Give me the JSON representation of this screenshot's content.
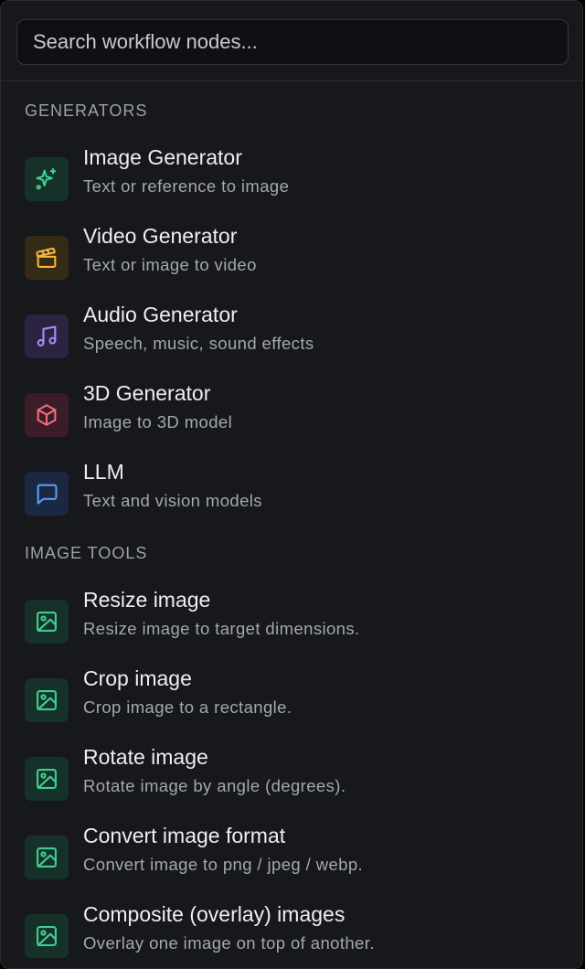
{
  "search": {
    "placeholder": "Search workflow nodes...",
    "value": ""
  },
  "sections": [
    {
      "title": "GENERATORS",
      "items": [
        {
          "title": "Image Generator",
          "description": "Text or reference to image",
          "icon": "sparkles-icon",
          "color": "#3ecf8e"
        },
        {
          "title": "Video Generator",
          "description": "Text or image to video",
          "icon": "clapperboard-icon",
          "color": "#f5b43c"
        },
        {
          "title": "Audio Generator",
          "description": "Speech, music, sound effects",
          "icon": "music-note-icon",
          "color": "#a78bfa"
        },
        {
          "title": "3D Generator",
          "description": "Image to 3D model",
          "icon": "cube-icon",
          "color": "#f06b82"
        },
        {
          "title": "LLM",
          "description": "Text and vision models",
          "icon": "chat-bubble-icon",
          "color": "#5b9cf0"
        }
      ]
    },
    {
      "title": "IMAGE TOOLS",
      "items": [
        {
          "title": "Resize image",
          "description": "Resize image to target dimensions.",
          "icon": "image-icon",
          "color": "#3ecf8e"
        },
        {
          "title": "Crop image",
          "description": "Crop image to a rectangle.",
          "icon": "image-icon",
          "color": "#3ecf8e"
        },
        {
          "title": "Rotate image",
          "description": "Rotate image by angle (degrees).",
          "icon": "image-icon",
          "color": "#3ecf8e"
        },
        {
          "title": "Convert image format",
          "description": "Convert image to png / jpeg / webp.",
          "icon": "image-icon",
          "color": "#3ecf8e"
        },
        {
          "title": "Composite (overlay) images",
          "description": "Overlay one image on top of another.",
          "icon": "image-icon",
          "color": "#3ecf8e"
        }
      ]
    }
  ]
}
